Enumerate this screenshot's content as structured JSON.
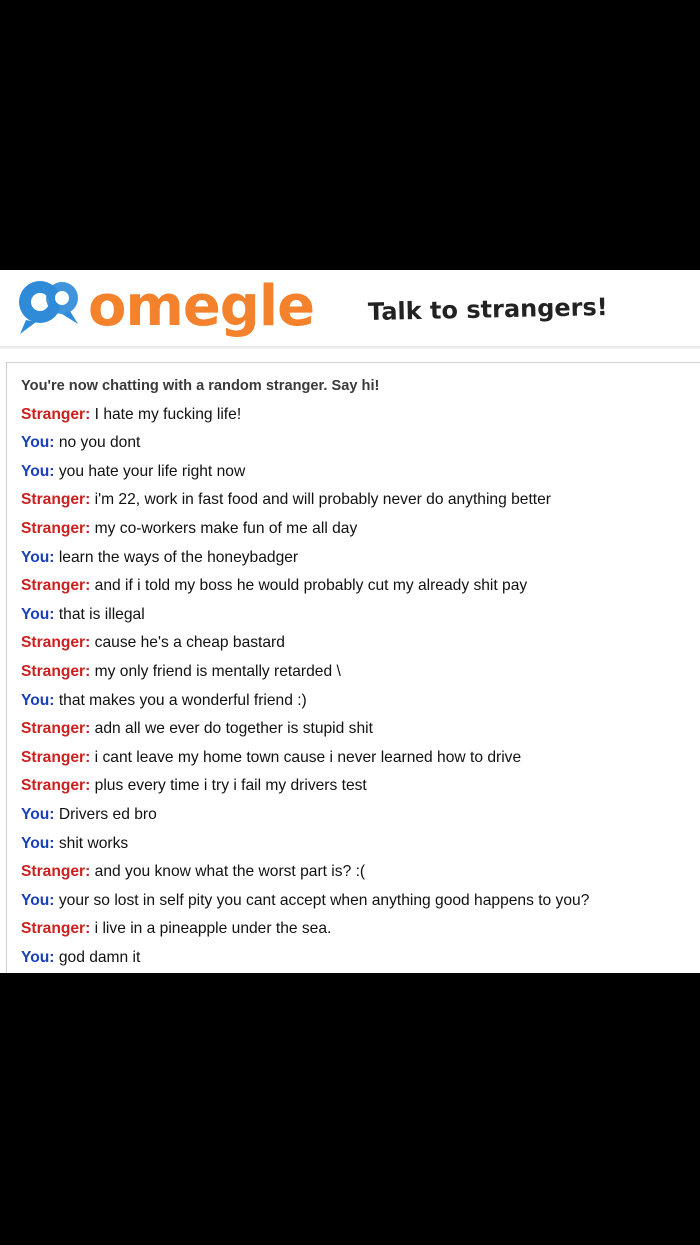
{
  "app": {
    "name": "omegle",
    "tagline": "Talk to strangers!"
  },
  "colors": {
    "brand_orange": "#f4812b",
    "brand_blue": "#2f8bd8",
    "stranger_label": "#cc2020",
    "you_label": "#1a3fb8",
    "background": "#000000"
  },
  "chat": {
    "status": "You're now chatting with a random stranger. Say hi!",
    "messages": [
      {
        "speaker": "stranger",
        "label": "Stranger:",
        "text": "I hate my fucking life!"
      },
      {
        "speaker": "you",
        "label": "You:",
        "text": "no you dont"
      },
      {
        "speaker": "you",
        "label": "You:",
        "text": "you hate your life right now"
      },
      {
        "speaker": "stranger",
        "label": "Stranger:",
        "text": "i'm 22, work in fast food and will probably never do anything better"
      },
      {
        "speaker": "stranger",
        "label": "Stranger:",
        "text": "my co-workers make fun of me all day"
      },
      {
        "speaker": "you",
        "label": "You:",
        "text": "learn the ways of the honeybadger"
      },
      {
        "speaker": "stranger",
        "label": "Stranger:",
        "text": "and if i told my boss he would probably cut my already shit pay"
      },
      {
        "speaker": "you",
        "label": "You:",
        "text": "that is illegal"
      },
      {
        "speaker": "stranger",
        "label": "Stranger:",
        "text": "cause he's a cheap bastard"
      },
      {
        "speaker": "stranger",
        "label": "Stranger:",
        "text": "my only friend is mentally retarded \\"
      },
      {
        "speaker": "you",
        "label": "You:",
        "text": "that makes you a wonderful friend :)"
      },
      {
        "speaker": "stranger",
        "label": "Stranger:",
        "text": "adn all we ever do together is stupid shit"
      },
      {
        "speaker": "stranger",
        "label": "Stranger:",
        "text": "i cant leave my home town cause i never learned how to drive"
      },
      {
        "speaker": "stranger",
        "label": "Stranger:",
        "text": "plus every time i try i fail my drivers test"
      },
      {
        "speaker": "you",
        "label": "You:",
        "text": "Drivers ed bro"
      },
      {
        "speaker": "you",
        "label": "You:",
        "text": "shit works"
      },
      {
        "speaker": "stranger",
        "label": "Stranger:",
        "text": "and you know what the worst part is? :("
      },
      {
        "speaker": "you",
        "label": "You:",
        "text": "your so lost in self pity you cant accept when anything good happens to you?"
      },
      {
        "speaker": "stranger",
        "label": "Stranger:",
        "text": "i live in a pineapple under the sea."
      },
      {
        "speaker": "you",
        "label": "You:",
        "text": "god damn it"
      }
    ]
  }
}
